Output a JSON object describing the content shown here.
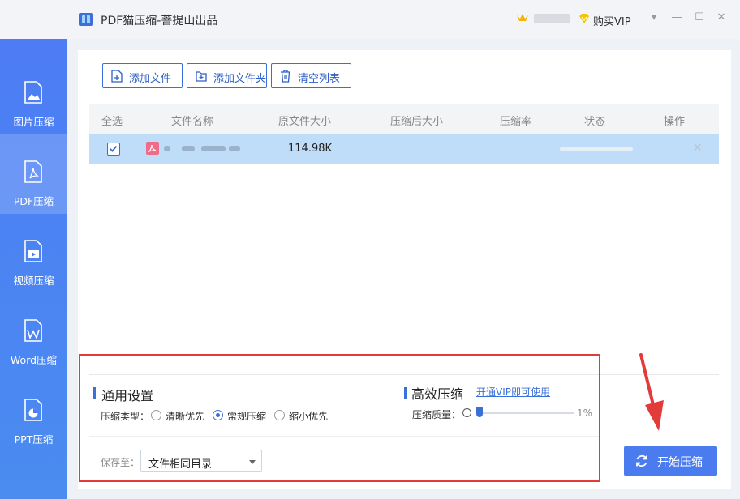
{
  "window": {
    "title": "PDF猫压缩-菩提山出品",
    "buy_vip": "购买VIP"
  },
  "sidebar": {
    "items": [
      {
        "label": "图片压缩",
        "icon": "image-file-icon",
        "active": false
      },
      {
        "label": "PDF压缩",
        "icon": "pdf-file-icon",
        "active": true
      },
      {
        "label": "视频压缩",
        "icon": "video-file-icon",
        "active": false
      },
      {
        "label": "Word压缩",
        "icon": "word-file-icon",
        "active": false
      },
      {
        "label": "PPT压缩",
        "icon": "ppt-file-icon",
        "active": false
      }
    ]
  },
  "toolbar": {
    "add_file": "添加文件",
    "add_folder": "添加文件夹",
    "clear_list": "清空列表"
  },
  "table": {
    "columns": [
      "全选",
      "文件名称",
      "原文件大小",
      "压缩后大小",
      "压缩率",
      "状态",
      "操作"
    ],
    "rows": [
      {
        "checked": true,
        "original_size": "114.98K",
        "compressed_size": "",
        "ratio": "",
        "status": ""
      }
    ]
  },
  "settings": {
    "general_title": "通用设置",
    "type_label": "压缩类型：",
    "options": [
      "清晰优先",
      "常规压缩",
      "缩小优先"
    ],
    "selected_option": "常规压缩",
    "efficient_title": "高效压缩",
    "vip_link": "开通VIP即可使用",
    "quality_label": "压缩质量：",
    "quality_value": "1%",
    "save_label": "保存至：",
    "save_value": "文件相同目录"
  },
  "actions": {
    "start": "开始压缩"
  },
  "colors": {
    "accent": "#4a7cf0",
    "sidebar": "#4d7cf5",
    "selected_row": "#bfdcf8",
    "annotation": "#e33a3a"
  }
}
